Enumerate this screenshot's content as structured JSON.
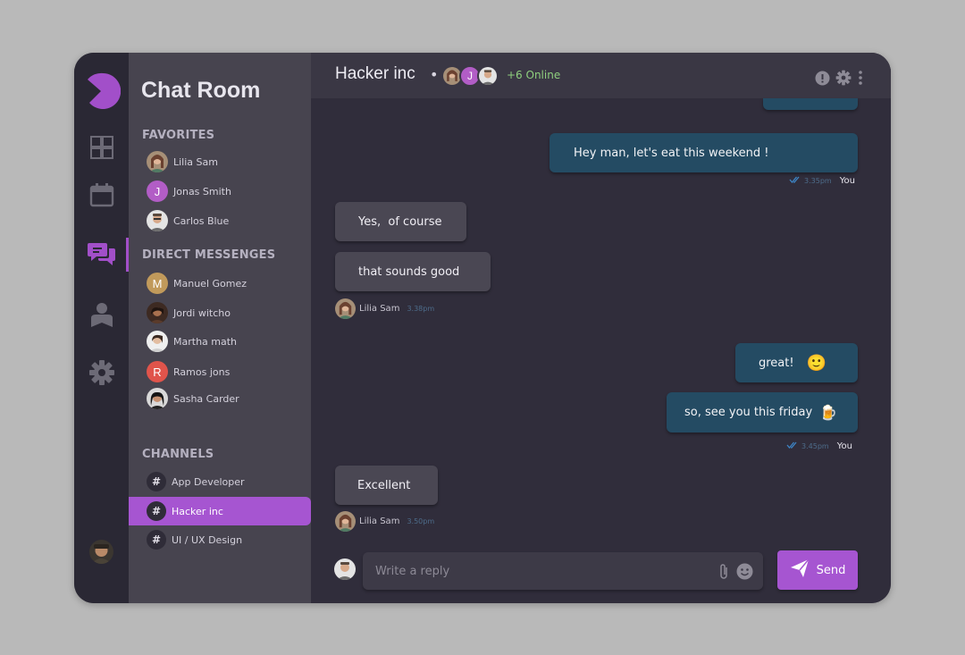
{
  "sidebar": {
    "title": "Chat Room",
    "favorites_heading": "FAVORITES",
    "favorites": [
      {
        "name": "Lilia Sam",
        "avatar": "photo"
      },
      {
        "name": "Jonas Smith",
        "initial": "J",
        "color": "#b25dc6"
      },
      {
        "name": "Carlos Blue",
        "avatar": "photo"
      }
    ],
    "dm_heading": "DIRECT MESSENGES",
    "direct_messages": [
      {
        "name": "Manuel Gomez",
        "initial": "M",
        "color": "#c19a5b"
      },
      {
        "name": "Jordi witcho",
        "avatar": "photo"
      },
      {
        "name": "Martha math",
        "avatar": "photo"
      },
      {
        "name": "Ramos jons",
        "initial": "R",
        "color": "#e0544b"
      },
      {
        "name": "Sasha Carder",
        "avatar": "photo"
      }
    ],
    "channels_heading": "CHANNELS",
    "channels": [
      {
        "name": "App Developer",
        "icon": "#"
      },
      {
        "name": "Hacker inc",
        "icon": "#",
        "active": true
      },
      {
        "name": "UI / UX Design",
        "icon": "#"
      }
    ]
  },
  "header": {
    "title": "Hacker inc",
    "separator": "•",
    "member_initial": "J",
    "online": "+6 Online"
  },
  "messages": [
    {
      "text": "Hey man, let's eat this weekend !",
      "direction": "out"
    },
    {
      "time": "3.35pm",
      "sender": "You"
    },
    {
      "text": "Yes,  of course",
      "direction": "in"
    },
    {
      "text": "that sounds good",
      "direction": "in"
    },
    {
      "time": "3.38pm",
      "sender": "Lilia Sam"
    },
    {
      "text": "great!",
      "emoji": "🙂",
      "direction": "out"
    },
    {
      "text": "so, see you this friday",
      "emoji": "🍺",
      "direction": "out"
    },
    {
      "time": "3.45pm",
      "sender": "You"
    },
    {
      "text": "Excellent",
      "direction": "in"
    },
    {
      "time": "3.50pm",
      "sender": "Lilia Sam"
    }
  ],
  "composer": {
    "placeholder": "Write a reply",
    "send_label": "Send"
  },
  "colors": {
    "accent": "#a655d1",
    "outgoing_bubble": "#244b63",
    "incoming_bubble": "#4a4753",
    "online": "#8fcf7e"
  },
  "icons": [
    "logo-icon",
    "puzzle-icon",
    "calendar-icon",
    "chat-icon",
    "contacts-icon",
    "settings-icon",
    "alert-icon",
    "gear-icon",
    "more-icon",
    "check-icon",
    "paperclip-icon",
    "emoji-icon",
    "send-icon"
  ]
}
